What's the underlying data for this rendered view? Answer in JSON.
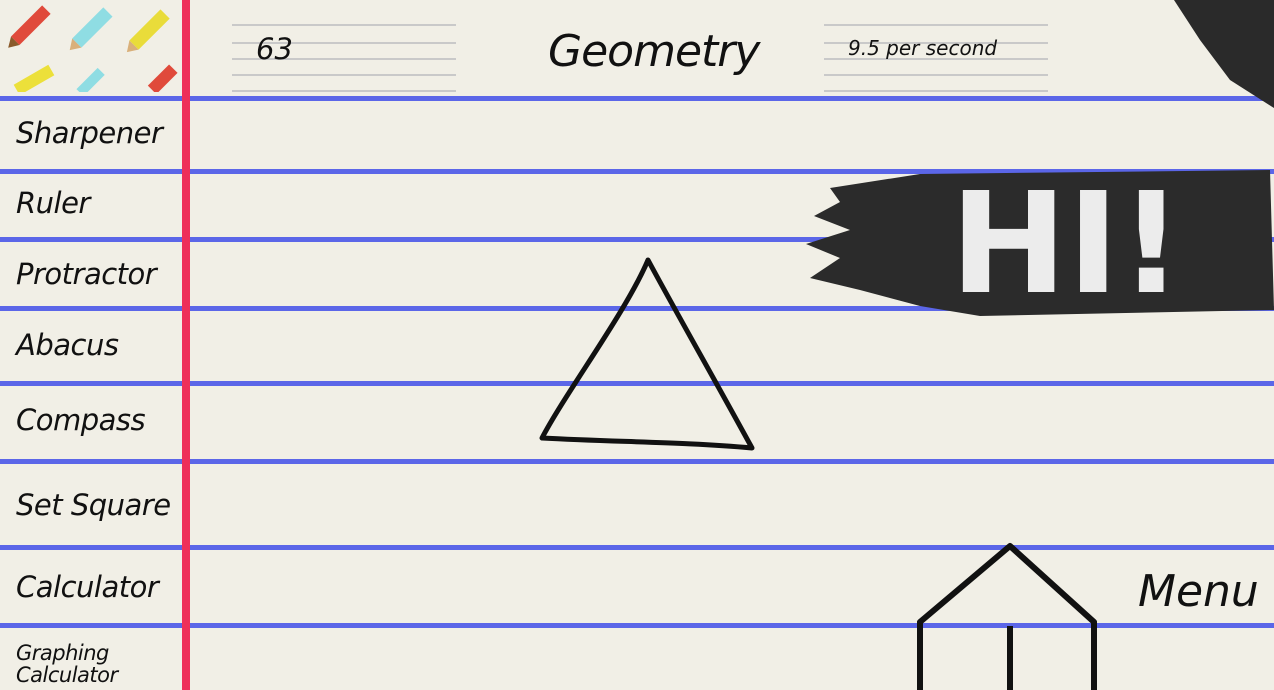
{
  "app": {
    "title": "Geometry",
    "count": "63",
    "rate": "9.5 per second",
    "menu_label": "Menu",
    "banner_text": "HI!"
  },
  "sidebar": {
    "items": [
      {
        "label": "Sharpener"
      },
      {
        "label": "Ruler"
      },
      {
        "label": "Protractor"
      },
      {
        "label": "Abacus"
      },
      {
        "label": "Compass"
      },
      {
        "label": "Set Square"
      },
      {
        "label": "Calculator"
      },
      {
        "label": "Graphing Calculator"
      }
    ]
  },
  "colors": {
    "paper": "#f1efe6",
    "rule_blue": "#4a57e8",
    "margin_red": "#ee2f5a",
    "ink": "#111111"
  },
  "icons": [
    "pencil-icon",
    "triangle-shape",
    "house-shape",
    "hi-banner"
  ]
}
